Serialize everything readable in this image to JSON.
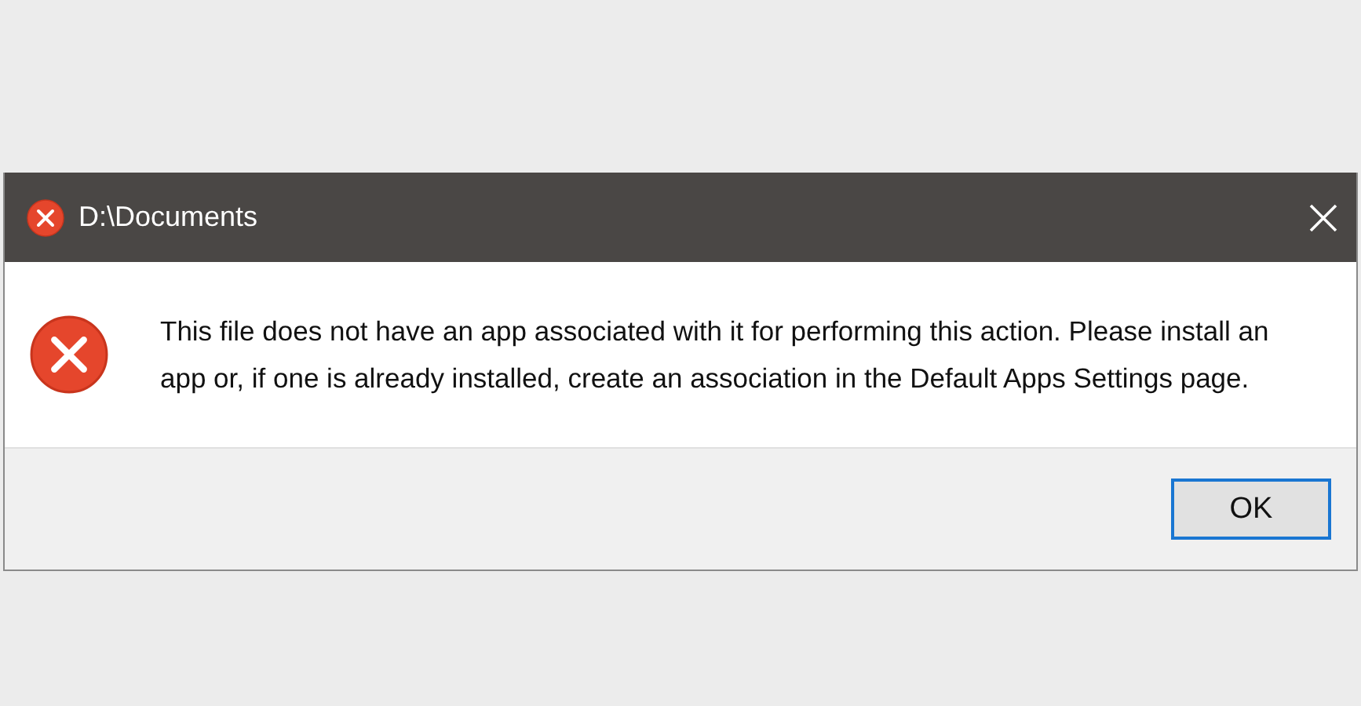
{
  "window": {
    "title": "D:\\Documents"
  },
  "message": {
    "kind": "error",
    "text": "This file does not have an app associated with it for performing this action. Please install an app or, if one is already installed, create an association in the Default Apps Settings page."
  },
  "buttons": [
    {
      "label": "OK",
      "focused": true
    }
  ]
}
